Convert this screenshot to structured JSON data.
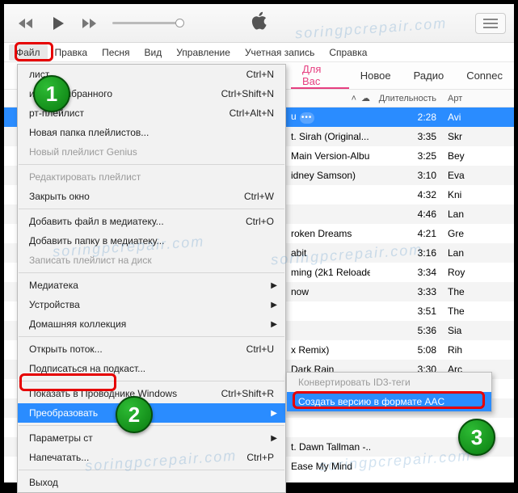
{
  "watermark": "soringpcrepair.com",
  "menubar": [
    "Файл",
    "Правка",
    "Песня",
    "Вид",
    "Управление",
    "Учетная запись",
    "Справка"
  ],
  "tabs": {
    "for_you": "Для Вас",
    "new": "Новое",
    "radio": "Радио",
    "connect": "Connec"
  },
  "columns": {
    "duration": "Длительность",
    "artist": "Арт"
  },
  "tracks": [
    {
      "name": "u",
      "dur": "2:28",
      "art": "Avi",
      "sel": true
    },
    {
      "name": "t. Sirah (Original...",
      "dur": "3:35",
      "art": "Skr"
    },
    {
      "name": "Main Version-Albu...",
      "dur": "3:25",
      "art": "Bey"
    },
    {
      "name": "idney Samson)",
      "dur": "3:10",
      "art": "Eva"
    },
    {
      "name": "",
      "dur": "4:32",
      "art": "Kni"
    },
    {
      "name": "",
      "dur": "4:46",
      "art": "Lan"
    },
    {
      "name": "roken Dreams",
      "dur": "4:21",
      "art": "Gre"
    },
    {
      "name": "abit",
      "dur": "3:16",
      "art": "Lan"
    },
    {
      "name": "ming (2k1 Reloade...",
      "dur": "3:34",
      "art": "Roy"
    },
    {
      "name": "now",
      "dur": "3:33",
      "art": "The"
    },
    {
      "name": "",
      "dur": "3:51",
      "art": "The"
    },
    {
      "name": "",
      "dur": "5:36",
      "art": "Sia"
    },
    {
      "name": "x Remix)",
      "dur": "5:08",
      "art": "Rih"
    },
    {
      "name": "Dark Rain",
      "dur": "3:30",
      "art": "Arc"
    },
    {
      "name": "",
      "dur": "",
      "art": ""
    },
    {
      "name": "",
      "dur": "",
      "art": ""
    },
    {
      "name": "",
      "dur": "",
      "art": ""
    },
    {
      "name": "t. Dawn Tallman -...",
      "dur": "",
      "art": ""
    },
    {
      "name": "Ease My Mind",
      "dur": "",
      "art": ""
    }
  ],
  "dropdown": [
    {
      "t": "item",
      "label": "лист",
      "short": "Ctrl+N"
    },
    {
      "t": "item",
      "label": "ист из выбранного",
      "short": "Ctrl+Shift+N"
    },
    {
      "t": "item",
      "label": "рт-плейлист",
      "short": "Ctrl+Alt+N"
    },
    {
      "t": "item",
      "label": "Новая папка плейлистов...",
      "has_arrow": false
    },
    {
      "t": "item",
      "label": "Новый плейлист Genius",
      "disabled": true
    },
    {
      "t": "sep"
    },
    {
      "t": "item",
      "label": "Редактировать плейлист",
      "disabled": true
    },
    {
      "t": "item",
      "label": "Закрыть окно",
      "short": "Ctrl+W"
    },
    {
      "t": "sep"
    },
    {
      "t": "item",
      "label": "Добавить файл в медиатеку...",
      "short": "Ctrl+O"
    },
    {
      "t": "item",
      "label": "Добавить папку в медиатеку..."
    },
    {
      "t": "item",
      "label": "Записать плейлист на диск",
      "disabled": true
    },
    {
      "t": "sep"
    },
    {
      "t": "item",
      "label": "Медиатека",
      "has_arrow": true
    },
    {
      "t": "item",
      "label": "Устройства",
      "has_arrow": true
    },
    {
      "t": "item",
      "label": "Домашняя коллекция",
      "has_arrow": true
    },
    {
      "t": "sep"
    },
    {
      "t": "item",
      "label": "Открыть поток...",
      "short": "Ctrl+U"
    },
    {
      "t": "item",
      "label": "Подписаться на подкаст..."
    },
    {
      "t": "sep"
    },
    {
      "t": "item",
      "label": "Показать в Проводнике Windows",
      "short": "Ctrl+Shift+R"
    },
    {
      "t": "item",
      "label": "Преобразовать",
      "has_arrow": true,
      "hover": true
    },
    {
      "t": "sep"
    },
    {
      "t": "item",
      "label": "Параметры ст",
      "has_arrow": true
    },
    {
      "t": "item",
      "label": "Напечатать...",
      "short": "Ctrl+P"
    },
    {
      "t": "sep"
    },
    {
      "t": "item",
      "label": "Выход"
    }
  ],
  "submenu": [
    {
      "label": "Конвертировать ID3-теги",
      "disabled": true
    },
    {
      "label": "Создать версию в формате AAC",
      "hover": true
    }
  ],
  "badges": {
    "b1": "1",
    "b2": "2",
    "b3": "3"
  }
}
